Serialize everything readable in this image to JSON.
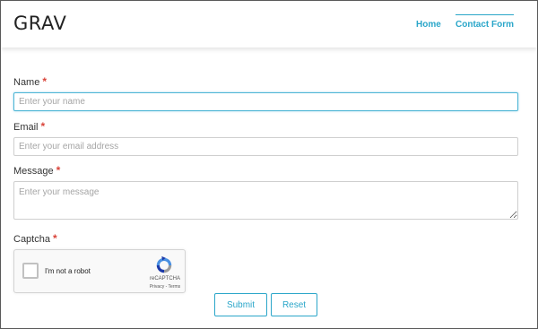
{
  "header": {
    "logo": "GRAV",
    "nav": [
      {
        "label": "Home",
        "active": false
      },
      {
        "label": "Contact Form",
        "active": true
      }
    ]
  },
  "form": {
    "required_marker": "*",
    "name": {
      "label": "Name",
      "placeholder": "Enter your name",
      "value": ""
    },
    "email": {
      "label": "Email",
      "placeholder": "Enter your email address",
      "value": ""
    },
    "message": {
      "label": "Message",
      "placeholder": "Enter your message",
      "value": ""
    },
    "captcha": {
      "label": "Captcha",
      "checkbox_text": "I'm not a robot",
      "brand": "reCAPTCHA",
      "links": "Privacy - Terms",
      "checked": false
    },
    "submit_label": "Submit",
    "reset_label": "Reset"
  },
  "colors": {
    "accent": "#2aa6c9",
    "required": "#d9443a",
    "focus_border": "#4fb6d6"
  },
  "icons": [
    "recaptcha-logo-icon"
  ]
}
